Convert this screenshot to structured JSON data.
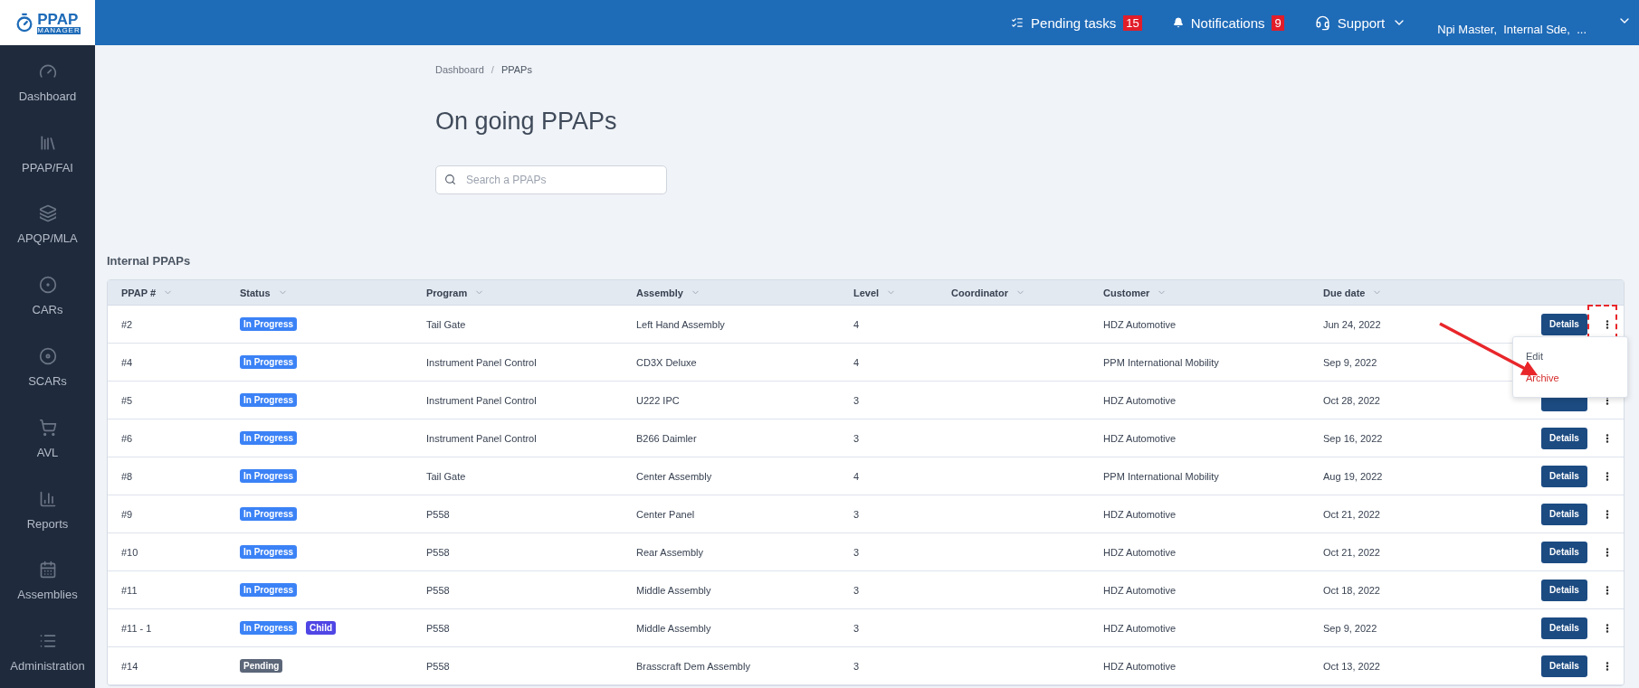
{
  "logo": {
    "title": "PPAP",
    "subtitle": "MANAGER"
  },
  "topbar": {
    "items": [
      {
        "label": "Pending tasks",
        "count": "15"
      },
      {
        "label": "Notifications",
        "count": "9"
      },
      {
        "label": "Support"
      }
    ],
    "user": "Npi Master,  Internal Sde,  ..."
  },
  "sidebar": {
    "items": [
      {
        "label": "Dashboard"
      },
      {
        "label": "PPAP/FAI"
      },
      {
        "label": "APQP/MLA"
      },
      {
        "label": "CARs"
      },
      {
        "label": "SCARs"
      },
      {
        "label": "AVL"
      },
      {
        "label": "Reports"
      },
      {
        "label": "Assemblies"
      },
      {
        "label": "Administration"
      }
    ]
  },
  "breadcrumb": {
    "items": [
      "Dashboard",
      "PPAPs"
    ],
    "separator": "/"
  },
  "title": "On going PPAPs",
  "search": {
    "placeholder": "Search a PPAPs"
  },
  "section_title": "Internal PPAPs",
  "table": {
    "columns": [
      "PPAP #",
      "Status",
      "Program",
      "Assembly",
      "Level",
      "Coordinator",
      "Customer",
      "Due date"
    ],
    "rows": [
      {
        "id": "#2",
        "badges": [
          {
            "label": "In Progress",
            "kind": "progress"
          }
        ],
        "program": "Tail Gate",
        "assembly": "Left Hand Assembly",
        "level": "4",
        "customer": "HDZ Automotive",
        "due": "Jun 24, 2022",
        "action": "Details",
        "menu": [
          {
            "label": "Edit",
            "kind": "normal"
          },
          {
            "label": "Archive",
            "kind": "danger"
          }
        ]
      },
      {
        "id": "#4",
        "badges": [
          {
            "label": "In Progress",
            "kind": "progress"
          }
        ],
        "program": "Instrument Panel Control",
        "assembly": "CD3X Deluxe",
        "level": "4",
        "customer": "PPM International Mobility",
        "due": "Sep 9, 2022"
      },
      {
        "id": "#5",
        "badges": [
          {
            "label": "In Progress",
            "kind": "progress"
          }
        ],
        "program": "Instrument Panel Control",
        "assembly": "U222 IPC",
        "level": "3",
        "customer": "HDZ Automotive",
        "due": "Oct 28, 2022",
        "details_covered": true
      },
      {
        "id": "#6",
        "badges": [
          {
            "label": "In Progress",
            "kind": "progress"
          }
        ],
        "program": "Instrument Panel Control",
        "assembly": "B266 Daimler",
        "level": "3",
        "customer": "HDZ Automotive",
        "due": "Sep 16, 2022",
        "action": "Details"
      },
      {
        "id": "#8",
        "badges": [
          {
            "label": "In Progress",
            "kind": "progress"
          }
        ],
        "program": "Tail Gate",
        "assembly": "Center Assembly",
        "level": "4",
        "customer": "PPM International Mobility",
        "due": "Aug 19, 2022",
        "action": "Details"
      },
      {
        "id": "#9",
        "badges": [
          {
            "label": "In Progress",
            "kind": "progress"
          }
        ],
        "program": "P558",
        "assembly": "Center Panel",
        "level": "3",
        "customer": "HDZ Automotive",
        "due": "Oct 21, 2022",
        "action": "Details"
      },
      {
        "id": "#10",
        "badges": [
          {
            "label": "In Progress",
            "kind": "progress"
          }
        ],
        "program": "P558",
        "assembly": "Rear Assembly",
        "level": "3",
        "customer": "HDZ Automotive",
        "due": "Oct 21, 2022",
        "action": "Details"
      },
      {
        "id": "#11",
        "badges": [
          {
            "label": "In Progress",
            "kind": "progress"
          }
        ],
        "program": "P558",
        "assembly": "Middle Assembly",
        "level": "3",
        "customer": "HDZ Automotive",
        "due": "Oct 18, 2022",
        "action": "Details"
      },
      {
        "id": "#11 - 1",
        "badges": [
          {
            "label": "In Progress",
            "kind": "progress"
          },
          {
            "label": "Child",
            "kind": "child"
          }
        ],
        "program": "P558",
        "assembly": "Middle Assembly",
        "level": "3",
        "customer": "HDZ Automotive",
        "due": "Sep 9, 2022",
        "action": "Details"
      },
      {
        "id": "#14",
        "badges": [
          {
            "label": "Pending",
            "kind": "pending"
          }
        ],
        "program": "P558",
        "assembly": "Brasscraft Dem Assembly",
        "level": "3",
        "customer": "HDZ Automotive",
        "due": "Oct 13, 2022",
        "action": "Details"
      }
    ]
  }
}
